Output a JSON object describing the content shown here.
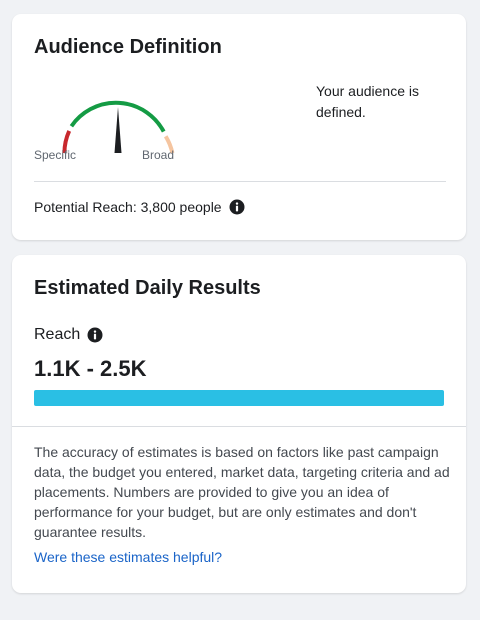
{
  "audience_definition": {
    "title": "Audience Definition",
    "gauge": {
      "left_label": "Specific",
      "right_label": "Broad",
      "needle_position": 0.5,
      "colors": {
        "narrow": "#c8282d",
        "good": "#149b44",
        "broad": "#f5c5a0",
        "needle": "#1c1e21"
      }
    },
    "status_text": "Your audience is defined.",
    "potential_reach": "Potential Reach: 3,800 people",
    "info_icon": "info-icon"
  },
  "estimated_daily_results": {
    "title": "Estimated Daily Results",
    "reach_label": "Reach",
    "reach_info_icon": "info-icon",
    "reach_range": "1.1K - 2.5K",
    "reach_bar_fill": 1.0,
    "reach_bar_color": "#2abfe4",
    "disclaimer": "The accuracy of estimates is based on factors like past campaign data, the budget you entered, market data, targeting criteria and ad placements. Numbers are provided to give you an idea of performance for your budget, but are only estimates and don't guarantee results.",
    "helpful_link": "Were these estimates helpful?",
    "link_color": "#1a64c8"
  }
}
